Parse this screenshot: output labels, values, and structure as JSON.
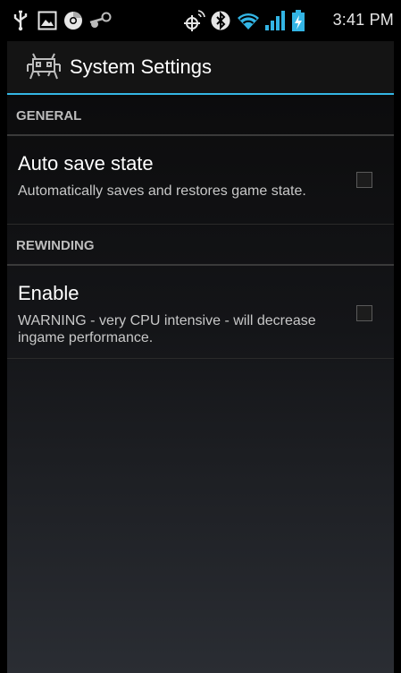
{
  "status_bar": {
    "time": "3:41 PM",
    "icons": [
      "usb-icon",
      "image-icon",
      "chrome-icon",
      "steam-icon",
      "gps-icon",
      "bluetooth-icon",
      "wifi-icon",
      "signal-icon",
      "battery-icon"
    ]
  },
  "action_bar": {
    "title": "System Settings",
    "app_icon": "retroarch-invader-icon"
  },
  "accent_color": "#33b5e5",
  "sections": [
    {
      "header": "GENERAL",
      "preference": {
        "title": "Auto save state",
        "summary": "Automatically saves and restores game state.",
        "checked": false
      }
    },
    {
      "header": "REWINDING",
      "preference": {
        "title": "Enable",
        "summary": "WARNING - very CPU intensive - will decrease ingame performance.",
        "checked": false
      }
    }
  ]
}
